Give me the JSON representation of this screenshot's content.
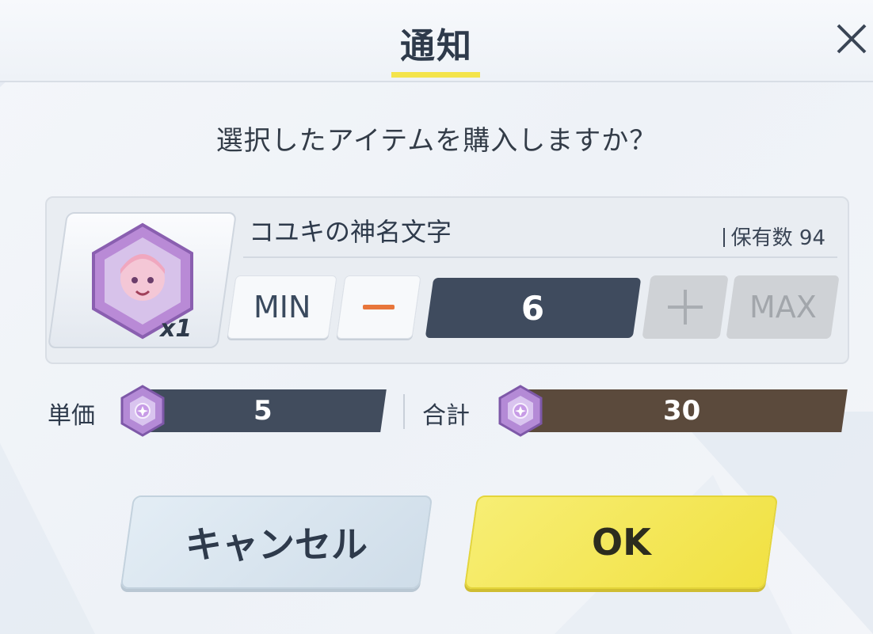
{
  "dialog": {
    "title": "通知",
    "question": "選択したアイテムを購入しますか？"
  },
  "item": {
    "name": "コユキの神名文字",
    "owned_label": "保有数",
    "owned_count": "94",
    "card_quantity": "x1"
  },
  "quantity": {
    "min_label": "MIN",
    "max_label": "MAX",
    "value": "6"
  },
  "price": {
    "unit_label": "単価",
    "unit_value": "5",
    "total_label": "合計",
    "total_value": "30"
  },
  "buttons": {
    "cancel": "キャンセル",
    "ok": "OK"
  },
  "colors": {
    "accent_yellow": "#f4e44b",
    "ok_button": "#f1e142",
    "quantity_box": "#3f4b5e",
    "total_bar": "#5b4a3c",
    "minus_icon": "#e8763b"
  },
  "icons": {
    "close": "close-icon",
    "gem": "pyroxene-gem-icon",
    "minus": "minus-icon",
    "plus": "plus-icon"
  }
}
